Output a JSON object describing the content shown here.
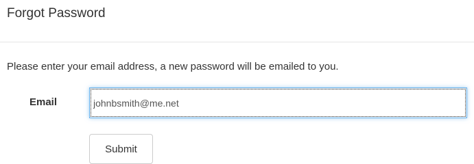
{
  "dialog": {
    "title": "Forgot Password",
    "instructions": "Please enter your email address, a new password will be emailed to you."
  },
  "form": {
    "email_label": "Email",
    "email_value": "johnbsmith@me.net",
    "submit_label": "Submit"
  }
}
